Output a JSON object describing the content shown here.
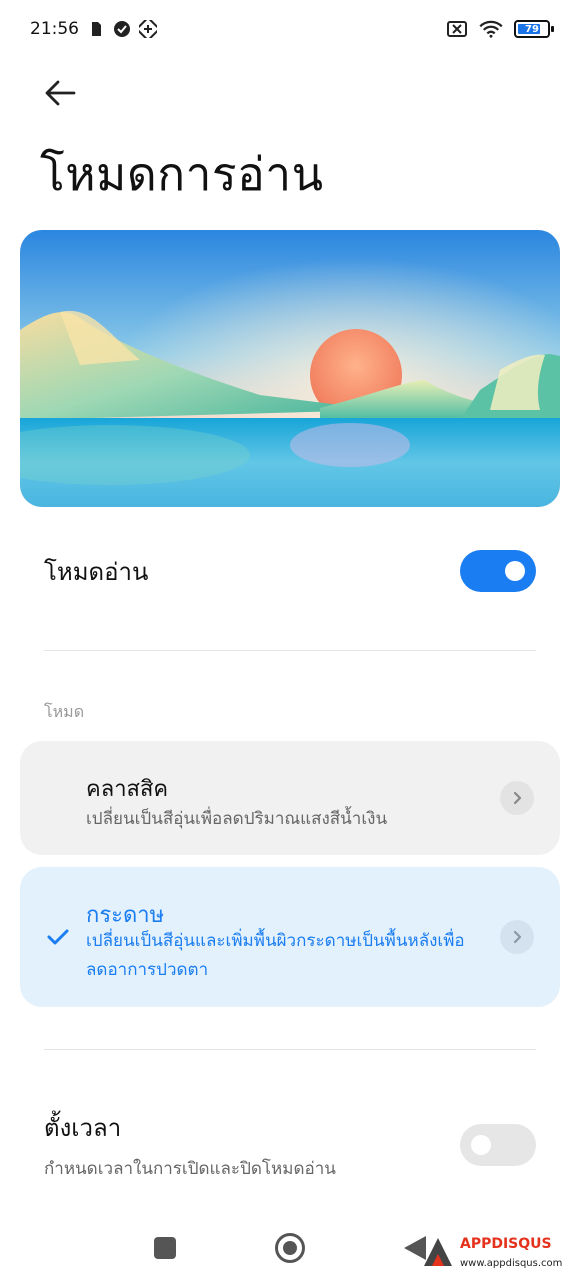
{
  "status_bar": {
    "time": "21:56",
    "battery": "79"
  },
  "header": {
    "title": "โหมดการอ่าน"
  },
  "reading_mode": {
    "label": "โหมดอ่าน",
    "enabled": true
  },
  "modes_section": {
    "label": "โหมด",
    "items": [
      {
        "title": "คลาสสิค",
        "description": "เปลี่ยนเป็นสีอุ่นเพื่อลดปริมาณแสงสีน้ำเงิน",
        "selected": false
      },
      {
        "title": "กระดาษ",
        "description": "เปลี่ยนเป็นสีอุ่นและเพิ่มพื้นผิวกระดาษเป็นพื้นหลังเพื่อลดอาการปวดตา",
        "selected": true
      }
    ]
  },
  "schedule": {
    "label": "ตั้งเวลา",
    "description": "กำหนดเวลาในการเปิดและปิดโหมดอ่าน",
    "enabled": false
  },
  "watermark": {
    "brand": "APPDISQUS",
    "url": "www.appdisqus.com"
  },
  "colors": {
    "accent": "#1a7df1",
    "selected_card_bg": "#e3f1fc",
    "card_bg": "#f1f1f1"
  }
}
